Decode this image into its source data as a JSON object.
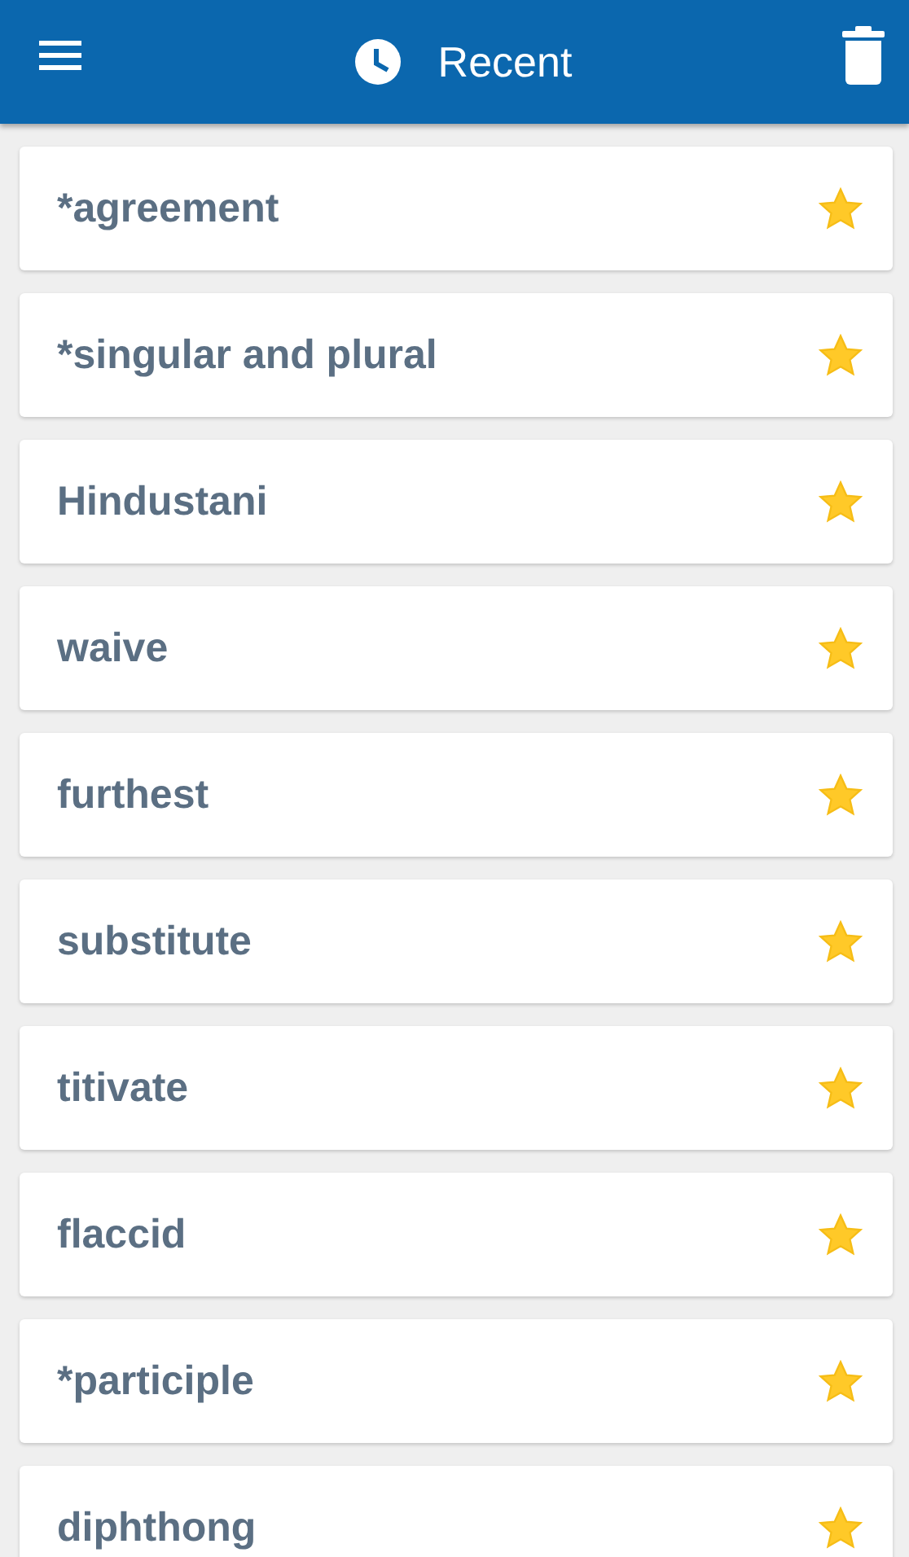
{
  "header": {
    "title": "Recent"
  },
  "items": [
    {
      "word": "*agreement",
      "favorite": true
    },
    {
      "word": "*singular and plural",
      "favorite": true
    },
    {
      "word": "Hindustani",
      "favorite": true
    },
    {
      "word": "waive",
      "favorite": true
    },
    {
      "word": "furthest",
      "favorite": true
    },
    {
      "word": "substitute",
      "favorite": true
    },
    {
      "word": "titivate",
      "favorite": true
    },
    {
      "word": "flaccid",
      "favorite": true
    },
    {
      "word": "*participle",
      "favorite": true
    },
    {
      "word": "diphthong",
      "favorite": true
    }
  ]
}
